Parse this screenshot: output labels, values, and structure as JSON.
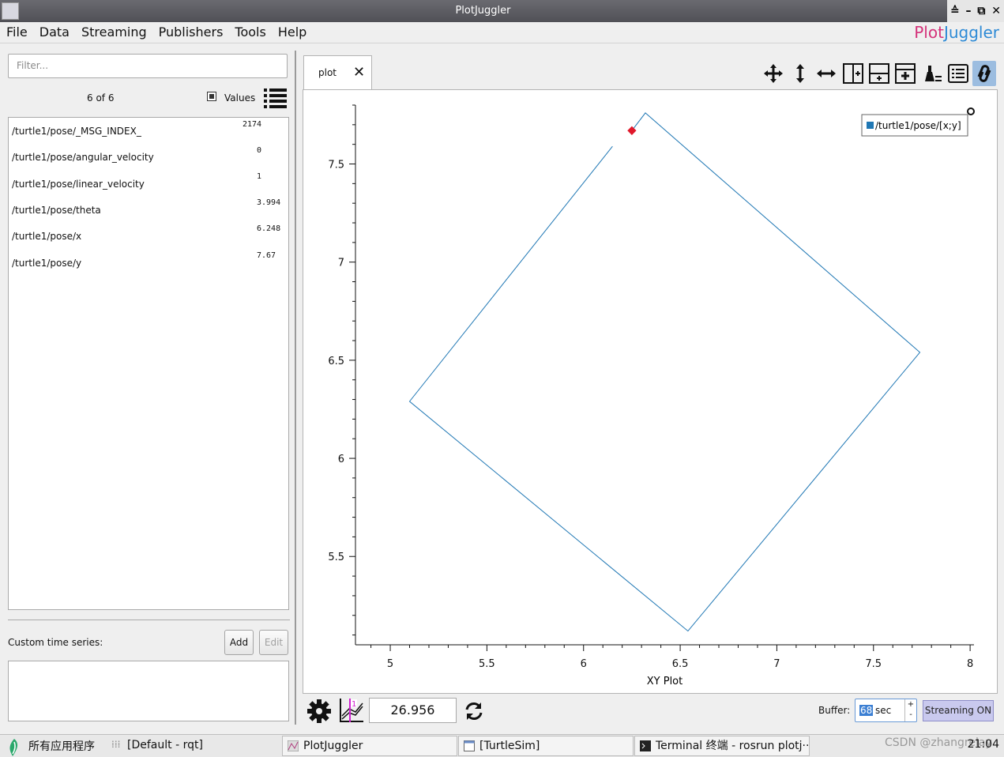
{
  "window": {
    "title": "PlotJuggler",
    "buttons": [
      "≙",
      "–",
      "⧉",
      "✕"
    ]
  },
  "menu": [
    "File",
    "Data",
    "Streaming",
    "Publishers",
    "Tools",
    "Help"
  ],
  "logo": {
    "part1": "Plot",
    "part2": "Juggler"
  },
  "left_panel": {
    "filter_placeholder": "Filter...",
    "count": "6 of 6",
    "values_label": "Values",
    "values_checked": true,
    "topics": [
      {
        "name": "/turtle1/pose/_MSG_INDEX_",
        "value": "2174"
      },
      {
        "name": "/turtle1/pose/angular_velocity",
        "value": "0"
      },
      {
        "name": "/turtle1/pose/linear_velocity",
        "value": "1"
      },
      {
        "name": "/turtle1/pose/theta",
        "value": "3.994"
      },
      {
        "name": "/turtle1/pose/x",
        "value": "6.248"
      },
      {
        "name": "/turtle1/pose/y",
        "value": "7.67"
      }
    ],
    "custom_label": "Custom time series:",
    "add_label": "Add",
    "edit_label": "Edit"
  },
  "tab": {
    "label": "plot",
    "close_icon": "close-icon"
  },
  "toolbar_icons": [
    "move-icon",
    "zoom-vertical-icon",
    "zoom-horizontal-icon",
    "split-horizontal-icon",
    "split-vertical-icon",
    "add-plot-icon",
    "clear-icon",
    "legend-icon",
    "link-icon"
  ],
  "chart_data": {
    "type": "line",
    "xlabel": "XY Plot",
    "ylabel": "",
    "xlim": [
      4.82,
      8.02
    ],
    "ylim": [
      5.05,
      7.8
    ],
    "x_ticks": [
      5,
      5.5,
      6,
      6.5,
      7,
      7.5,
      8
    ],
    "y_ticks": [
      5.5,
      6,
      6.5,
      7,
      7.5
    ],
    "series": [
      {
        "name": "/turtle1/pose/[x;y]",
        "color": "#1f77b4",
        "points": [
          [
            6.15,
            7.59
          ],
          [
            5.1,
            6.29
          ],
          [
            6.54,
            5.12
          ],
          [
            7.74,
            6.54
          ],
          [
            6.32,
            7.76
          ],
          [
            6.25,
            7.67
          ]
        ]
      }
    ],
    "marker": {
      "x": 6.25,
      "y": 7.67,
      "color": "#e0182b"
    },
    "legend": "top-right",
    "grid": false
  },
  "bottom_bar": {
    "time_value": "26.956",
    "buffer_label": "Buffer:",
    "buffer_value": "68",
    "buffer_unit": "sec",
    "streaming_button": "Streaming ON"
  },
  "taskbar": {
    "start_label": "所有应用程序",
    "tasks": [
      "[Default - rqt]",
      "PlotJuggler",
      "[TurtleSim]",
      "Terminal 终端 - rosrun plotj···"
    ],
    "watermark": "CSDN @zhangrelay",
    "clock": "21:04"
  }
}
